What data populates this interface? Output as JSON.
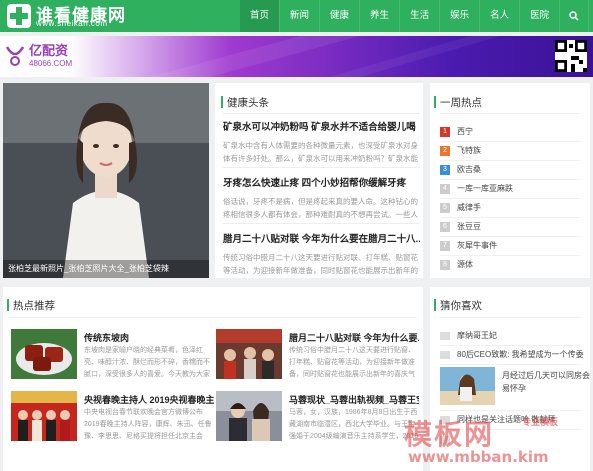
{
  "header": {
    "logo_name": "谁看健康网",
    "logo_url": "www.sheikan.com",
    "nav": [
      {
        "label": "首页"
      },
      {
        "label": "新闻"
      },
      {
        "label": "健康"
      },
      {
        "label": "养生"
      },
      {
        "label": "生活"
      },
      {
        "label": "娱乐"
      },
      {
        "label": "名人"
      },
      {
        "label": "医院"
      }
    ],
    "search_icon": "search-icon",
    "share_icon": "share-icon",
    "colors": {
      "brand": "#2eb05e",
      "active": "#259a50"
    }
  },
  "banner": {
    "logo_name": "亿配资",
    "logo_url": "48066.COM"
  },
  "hero": {
    "caption": "张柏芝最新照片_张柏芝照片大全_张柏芝袋辣"
  },
  "health_news": {
    "title": "健康头条",
    "items": [
      {
        "title": "矿泉水可以冲奶粉吗 矿泉水并不适合给婴儿喝",
        "excerpt": "矿泉水中含有人体需要的各种微量元素，也深受矿泉水对身体有许多好处。那么，矿泉水可以用来冲奶粉吗？矿泉水能用"
      },
      {
        "title": "牙疼怎么快速止疼 四个小妙招帮你缓解牙疼",
        "excerpt": "俗话说，牙疼不是病，但是疼起来真的要人命。这种钻心的疼相信很多人都有体会，那种难耐真的不想再尝试。一些人"
      },
      {
        "title": "腊月二十八贴对联 今年为什么要在腊月二十八...",
        "excerpt": "传统习俗中腊月二十八这天要进行贴对联、打年糕、贴窗花等活动，为迎接新年做准备，同时贴窗花也能展示出新年的喜"
      }
    ]
  },
  "hot_week": {
    "title": "一周热点",
    "items": [
      {
        "num": "1",
        "label": "西宁",
        "color": "#d9362b"
      },
      {
        "num": "2",
        "label": "飞特族",
        "color": "#e8792c"
      },
      {
        "num": "3",
        "label": "欧吉桑",
        "color": "#3b8fd4"
      },
      {
        "num": "4",
        "label": "一库一库亚麻跌",
        "color": "#cccccc"
      },
      {
        "num": "5",
        "label": "威律手",
        "color": "#cccccc"
      },
      {
        "num": "6",
        "label": "张豆豆",
        "color": "#cccccc"
      },
      {
        "num": "7",
        "label": "灰犀牛事件",
        "color": "#cccccc"
      },
      {
        "num": "8",
        "label": "源体",
        "color": "#cccccc"
      }
    ]
  },
  "recommend": {
    "title": "热点推荐",
    "items": [
      {
        "title": "传统东坡肉",
        "excerpt": "东坡肉是家喻户晓的经典菜肴，色泽红亮、味醇汁浓、酥烂而形不碎，香糯而不腻口，深受很多人的喜爱。今天教为大家"
      },
      {
        "title": "腊月二十八贴对联 今年为什么要...",
        "excerpt": "传统习俗中腊月二十八这天要进行贴窗、打年糕、贴窗花等活动，为迎接新年做准备，同时贴窗花也能展示出新年的喜庆气"
      },
      {
        "title": "央视春晚主持人 2019央视春晚主...",
        "excerpt": "中央电视台春节联欢晚会官方微博公布2019春晚主持人阵容，康辉、朱迅、任鲁豫、李思思、尼格买提将担任北京主会"
      },
      {
        "title": "马蓉现状_马蓉出轨视频_马蓉王宝...",
        "excerpt": "马蓉，女，汉族，1986年8月8日出生于西藏湖南市临澧区，西北大学毕业。与王宝强婚于2004级编演音乐主持系学生，2016年8月"
      }
    ]
  },
  "guess_like": {
    "title": "猜你喜欢",
    "items": [
      {
        "label": "摩纳哥王妃"
      },
      {
        "label": "80后CEO致歉: 我希望成为一个传委"
      }
    ],
    "image_item": {
      "label": "月经过后几天可以同房会易怀孕"
    },
    "more_items": [
      {
        "label": "同样也是关注话题哈 敬献拜"
      },
      {
        "label": ""
      }
    ]
  },
  "watermark": {
    "text": "模板网",
    "tag": "专业模板",
    "url": "www.mbban.kim"
  }
}
